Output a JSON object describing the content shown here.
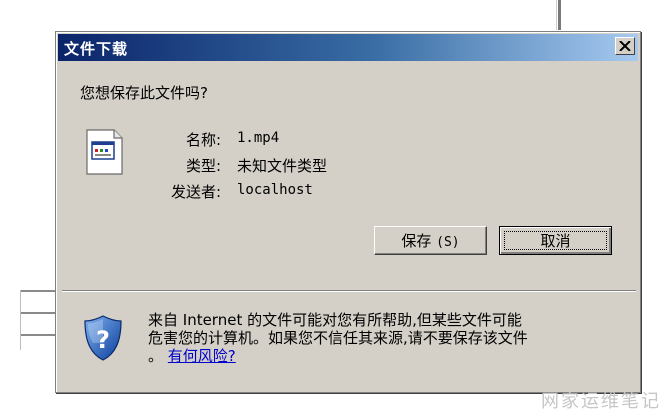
{
  "dialog": {
    "title": "文件下载",
    "question": "您想保存此文件吗?"
  },
  "file_info": {
    "name_label": "名称:",
    "name_value": "1.mp4",
    "type_label": "类型:",
    "type_value": "未知文件类型",
    "sender_label": "发送者:",
    "sender_value": "localhost"
  },
  "buttons": {
    "save_label": "保存",
    "save_mnemonic": "(S)",
    "cancel_label": "取消"
  },
  "warning": {
    "line1": "来自 Internet 的文件可能对您有所帮助,但某些文件可能",
    "line2": "危害您的计算机。如果您不信任其来源,请不要保存该文件",
    "line3_prefix": "。",
    "link": "有何风险?"
  },
  "watermark": "网家运维笔记",
  "icons": {
    "close": "close-icon",
    "file": "file-icon",
    "shield": "security-shield-icon"
  },
  "colors": {
    "title_gradient_start": "#0a246a",
    "title_gradient_end": "#a6caf0",
    "dialog_face": "#d4d0c8",
    "link": "#0000cc"
  }
}
